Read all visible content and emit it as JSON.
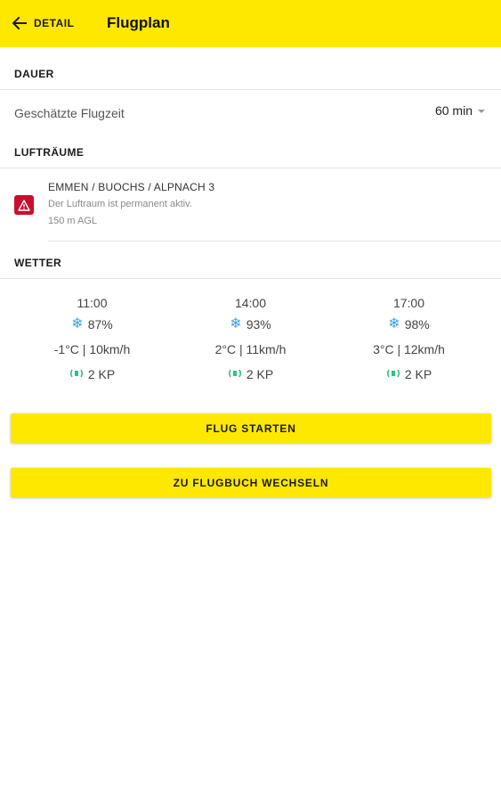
{
  "header": {
    "back_label": "DETAIL",
    "title": "Flugplan",
    "background_color": "#ffe800"
  },
  "duration": {
    "section_title": "DAUER",
    "label": "Geschätzte Flugzeit",
    "value": "60 min"
  },
  "airspaces": {
    "section_title": "LUFTRÄUME",
    "items": [
      {
        "name": "EMMEN / BUOCHS / ALPNACH 3",
        "status": "Der Luftraum ist permanent aktiv.",
        "altitude": "150 m AGL",
        "icon": "warning-icon",
        "badge_color": "#c8102e"
      }
    ]
  },
  "weather": {
    "section_title": "WETTER",
    "columns": [
      {
        "time": "11:00",
        "humidity": "87%",
        "temp_wind": "-1°C | 10km/h",
        "kp": "2 KP"
      },
      {
        "time": "14:00",
        "humidity": "93%",
        "temp_wind": "2°C | 11km/h",
        "kp": "2 KP"
      },
      {
        "time": "17:00",
        "humidity": "98%",
        "temp_wind": "3°C | 12km/h",
        "kp": "2 KP"
      }
    ],
    "icons": {
      "humidity": "snowflake-icon",
      "kp": "signal-icon"
    },
    "snow_color": "#3aa0e8",
    "kp_color": "#2ec27e"
  },
  "actions": {
    "start_flight": "FLUG STARTEN",
    "switch_logbook": "ZU FLUGBUCH WECHSELN",
    "button_color": "#ffe800"
  }
}
